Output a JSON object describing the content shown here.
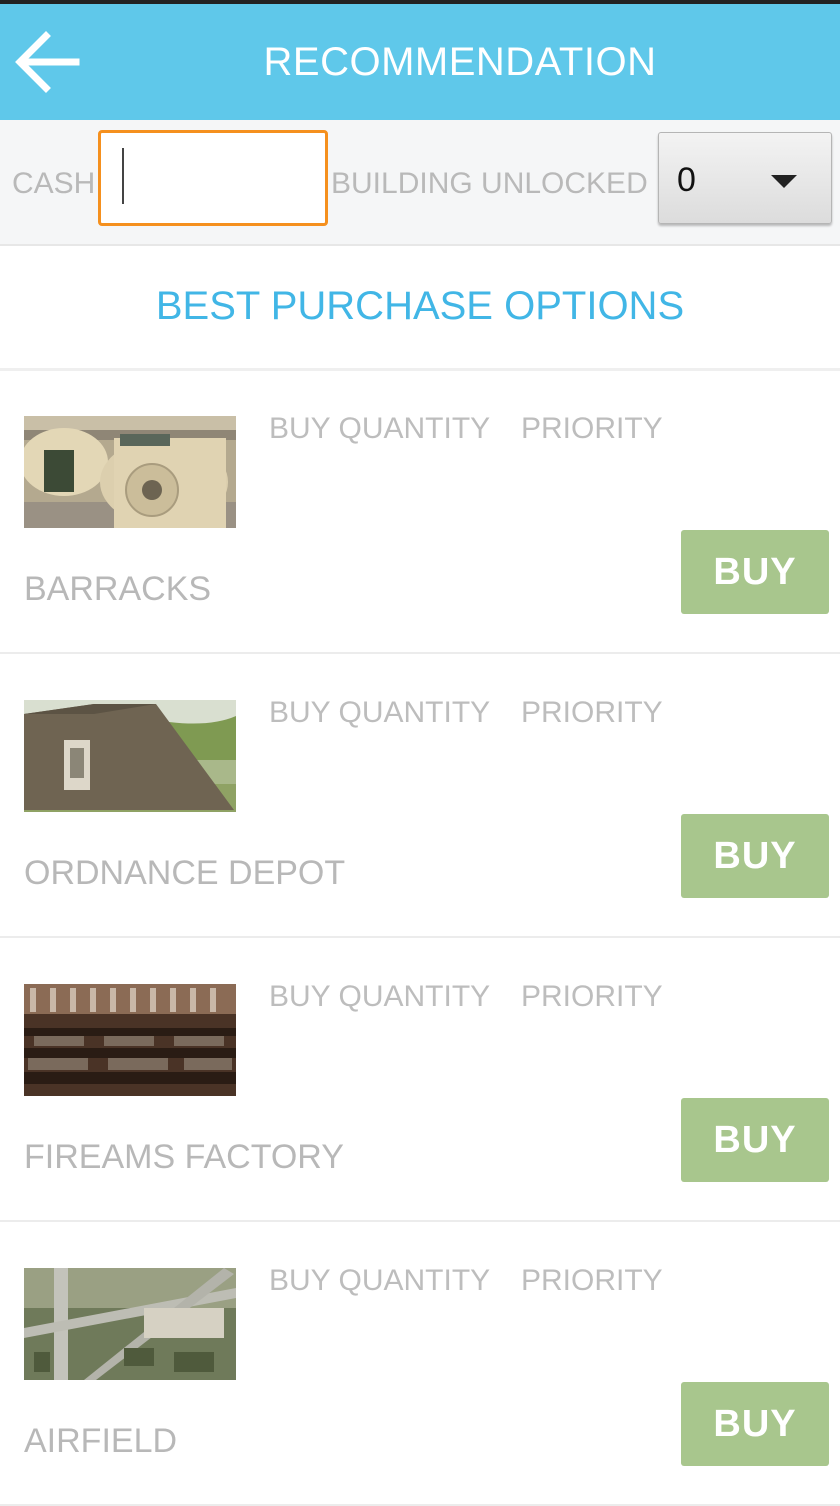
{
  "header": {
    "title": "RECOMMENDATION",
    "back_icon": "arrow-left-icon"
  },
  "filters": {
    "cash_label": "CASH",
    "cash_value": "",
    "building_unlocked_label": "BUILDING UNLOCKED",
    "building_unlocked_value": "0"
  },
  "section": {
    "title": "BEST PURCHASE OPTIONS"
  },
  "items": [
    {
      "name": "BARRACKS",
      "qty_label": "BUY QUANTITY",
      "priority_label": "PRIORITY",
      "buy_label": "BUY"
    },
    {
      "name": "ORDNANCE DEPOT",
      "qty_label": "BUY QUANTITY",
      "priority_label": "PRIORITY",
      "buy_label": "BUY"
    },
    {
      "name": "FIREAMS FACTORY",
      "qty_label": "BUY QUANTITY",
      "priority_label": "PRIORITY",
      "buy_label": "BUY"
    },
    {
      "name": "AIRFIELD",
      "qty_label": "BUY QUANTITY",
      "priority_label": "PRIORITY",
      "buy_label": "BUY"
    }
  ],
  "colors": {
    "appbar": "#5fc8ea",
    "section_title": "#41b6e6",
    "cash_input_border": "#f5901e",
    "buy_button": "#a8c68d"
  }
}
